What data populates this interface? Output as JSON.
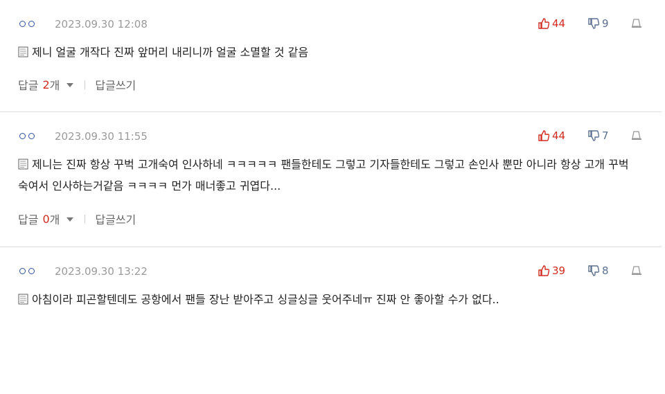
{
  "comments": [
    {
      "author": "ㅇㅇ",
      "date": "2023.09.30 12:08",
      "likes": "44",
      "dislikes": "9",
      "text": "제니 얼굴 개작다 진짜 앞머리 내리니까 얼굴 소멸할 것 같음",
      "reply_label": "답글",
      "reply_count": "2",
      "reply_unit": "개",
      "write_reply_label": "답글쓰기"
    },
    {
      "author": "ㅇㅇ",
      "date": "2023.09.30 11:55",
      "likes": "44",
      "dislikes": "7",
      "text": "제니는 진짜 항상 꾸벅 고개숙여 인사하네 ㅋㅋㅋㅋㅋ 팬들한테도 그렇고 기자들한테도 그렇고 손인사 뿐만 아니라 항상 고개 꾸벅 숙여서 인사하는거같음 ㅋㅋㅋㅋ 먼가 매너좋고 귀엽다...",
      "reply_label": "답글",
      "reply_count": "0",
      "reply_unit": "개",
      "write_reply_label": "답글쓰기"
    },
    {
      "author": "ㅇㅇ",
      "date": "2023.09.30 13:22",
      "likes": "39",
      "dislikes": "8",
      "text": "아침이라 피곤할텐데도 공항에서 팬들 장난 받아주고 싱글싱글 웃어주네ㅠ 진짜 안 좋아할 수가 없다.."
    }
  ],
  "icons": {
    "like": "thumbs-up-icon",
    "dislike": "thumbs-down-icon",
    "report": "report-icon",
    "text_prefix": "document-icon",
    "reply_toggle": "chevron-down-icon"
  },
  "colors": {
    "author": "#2b52a4",
    "like": "#d22a1e",
    "dislike": "#5a6f8f",
    "reply_count": "#d22a1e",
    "date": "#9a9a9a"
  }
}
